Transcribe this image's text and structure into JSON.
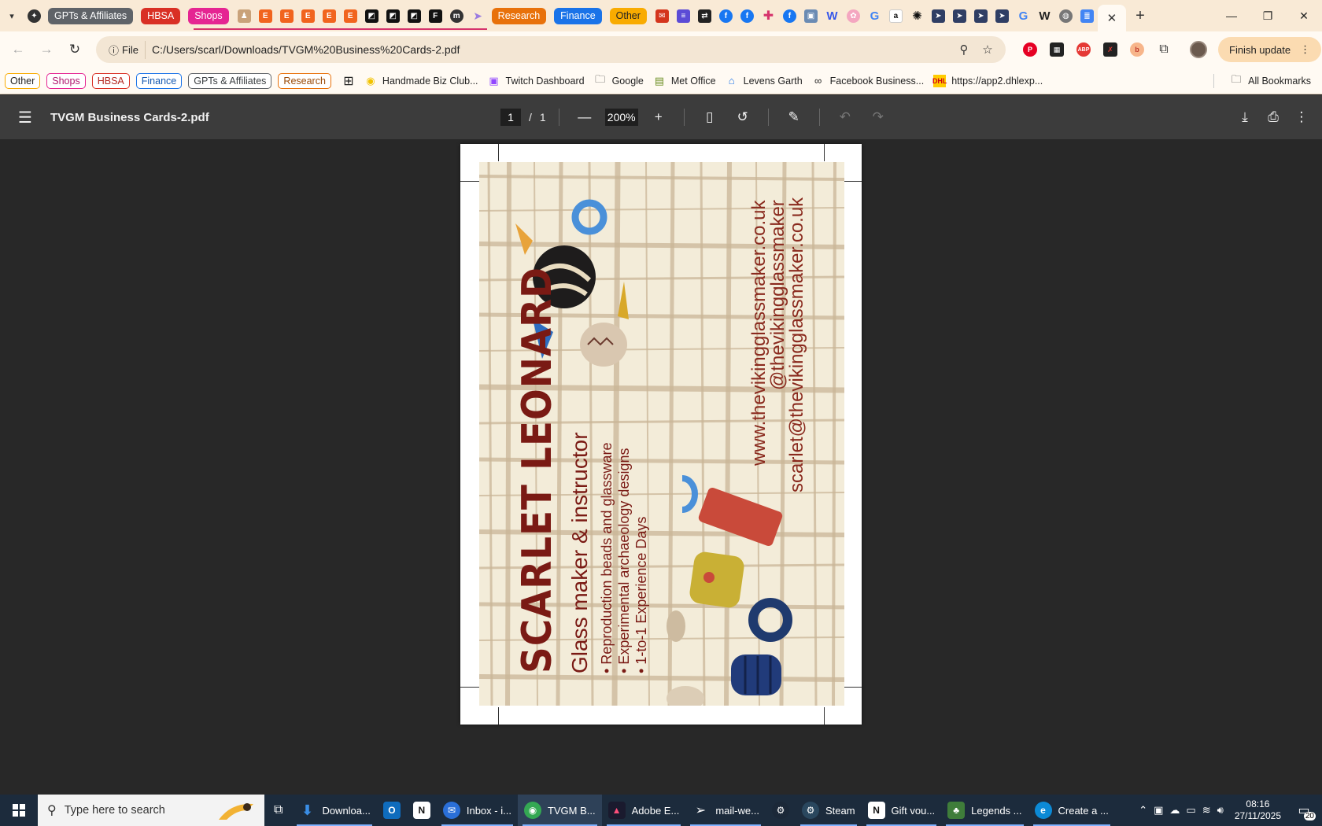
{
  "window": {
    "tab_groups": [
      {
        "label": "GPTs & Affiliates",
        "color": "#5f6368"
      },
      {
        "label": "HBSA",
        "color": "#d93025"
      },
      {
        "label": "Shops",
        "color": "#e52592"
      },
      {
        "label": "Research",
        "color": "#e8710a"
      },
      {
        "label": "Finance",
        "color": "#1a73e8"
      },
      {
        "label": "Other",
        "color": "#f9ab00"
      }
    ],
    "controls": {
      "minimize": "—",
      "restore": "❐",
      "close": "✕"
    },
    "new_tab": "+"
  },
  "toolbar": {
    "back": "←",
    "forward": "→",
    "reload": "↻",
    "site_info": "File",
    "url": "C:/Users/scarl/Downloads/TVGM%20Business%20Cards-2.pdf",
    "finish_update": "Finish update"
  },
  "bookmarks": {
    "chips": [
      {
        "label": "Other",
        "color": "#f9ab00"
      },
      {
        "label": "Shops",
        "color": "#e52592"
      },
      {
        "label": "HBSA",
        "color": "#d93025"
      },
      {
        "label": "Finance",
        "color": "#1a73e8"
      },
      {
        "label": "GPTs & Affiliates",
        "color": "#5f6368"
      },
      {
        "label": "Research",
        "color": "#e8710a"
      }
    ],
    "items": [
      {
        "label": "Handmade Biz Club...",
        "icon": "handmade-biz-icon"
      },
      {
        "label": "Twitch Dashboard",
        "icon": "twitch-icon"
      },
      {
        "label": "Google",
        "icon": "folder-icon"
      },
      {
        "label": "Met Office",
        "icon": "met-office-icon"
      },
      {
        "label": "Levens Garth",
        "icon": "home-icon"
      },
      {
        "label": "Facebook Business...",
        "icon": "meta-icon"
      },
      {
        "label": "https://app2.dhlexp...",
        "icon": "dhl-icon"
      }
    ],
    "all_bookmarks": "All Bookmarks"
  },
  "pdf": {
    "title": "TVGM Business Cards-2.pdf",
    "page_current": "1",
    "page_sep": "/",
    "page_total": "1",
    "zoom": "200%"
  },
  "card": {
    "name": "SCARLET LEONARD",
    "subtitle": "Glass maker & instructor",
    "bullets": [
      "Reproduction beads and glassware",
      "Experimental archaeology designs",
      "1-to-1 Experience Days"
    ],
    "website": "www.thevikingglassmaker.co.uk",
    "handle": "@thevikingglassmaker",
    "email": "scarlet@thevikingglassmaker.co.uk",
    "colors": {
      "text": "#7a1a14",
      "background": "#f3ecd9",
      "weave": "#c9b697"
    }
  },
  "taskbar": {
    "search_placeholder": "Type here to search",
    "items": [
      {
        "label": "Downloa...",
        "icon": "download-icon",
        "color": "#3a8ee6"
      },
      {
        "label": "",
        "icon": "outlook-icon",
        "color": "#0f6cbd"
      },
      {
        "label": "",
        "icon": "notion-icon",
        "color": "#222222"
      },
      {
        "label": "Inbox - i...",
        "icon": "thunderbird-icon",
        "color": "#2a6fd8"
      },
      {
        "label": "TVGM B...",
        "icon": "chrome-icon",
        "color": "#34a853"
      },
      {
        "label": "Adobe E...",
        "icon": "adobe-express-icon",
        "color": "#1a1a2e"
      },
      {
        "label": "mail-we...",
        "icon": "send-icon",
        "color": "#1c2b3c"
      },
      {
        "label": "",
        "icon": "steam-icon",
        "color": "#1b2838"
      },
      {
        "label": "Steam",
        "icon": "steam-icon",
        "color": "#2a475e"
      },
      {
        "label": "Gift vou...",
        "icon": "notion-icon",
        "color": "#222222"
      },
      {
        "label": "Legends ...",
        "icon": "game-icon",
        "color": "#3f7d3a"
      },
      {
        "label": "Create a ...",
        "icon": "edge-icon",
        "color": "#0c8ad6"
      }
    ],
    "time": "08:16",
    "date": "27/11/2025",
    "notifications": "20"
  }
}
